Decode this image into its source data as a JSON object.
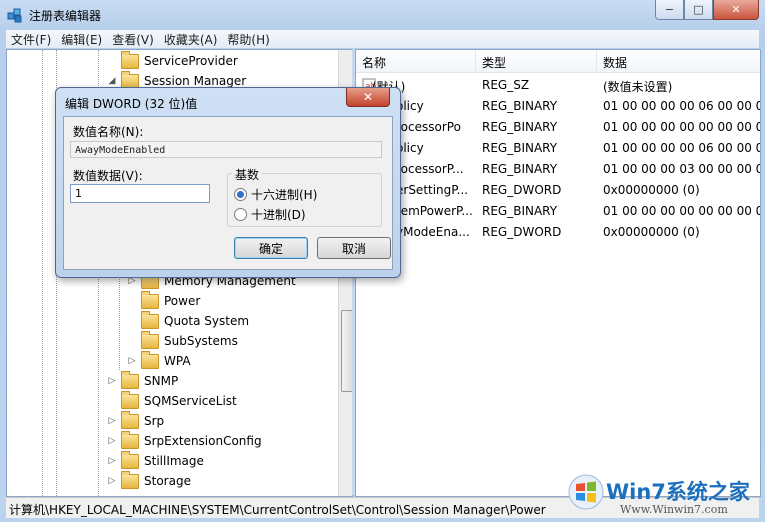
{
  "window": {
    "title": "注册表编辑器",
    "controls": {
      "minimize": "−",
      "maximize": "□",
      "close": "✕"
    }
  },
  "menu": [
    "文件(F)",
    "编辑(E)",
    "查看(V)",
    "收藏夹(A)",
    "帮助(H)"
  ],
  "tree": {
    "items": [
      {
        "label": "ServiceProvider",
        "expander": ""
      },
      {
        "label": "Session Manager",
        "expander": "◢"
      },
      {
        "label": "Memory Management",
        "expander": "▷"
      },
      {
        "label": "Power",
        "expander": ""
      },
      {
        "label": "Quota System",
        "expander": ""
      },
      {
        "label": "SubSystems",
        "expander": ""
      },
      {
        "label": "WPA",
        "expander": "▷"
      },
      {
        "label": "SNMP",
        "expander": "▷"
      },
      {
        "label": "SQMServiceList",
        "expander": ""
      },
      {
        "label": "Srp",
        "expander": "▷"
      },
      {
        "label": "SrpExtensionConfig",
        "expander": "▷"
      },
      {
        "label": "StillImage",
        "expander": "▷"
      },
      {
        "label": "Storage",
        "expander": "▷"
      }
    ]
  },
  "list": {
    "headers": {
      "name": "名称",
      "type": "类型",
      "data": "数据"
    },
    "rows": [
      {
        "name": "(默认)",
        "type": "REG_SZ",
        "data": "(数值未设置)"
      },
      {
        "name": "olicy",
        "type": "REG_BINARY",
        "data": "01 00 00 00 00 06 00 00 00 03"
      },
      {
        "name": "rocessorPo",
        "type": "REG_BINARY",
        "data": "01 00 00 00 00 00 00 00 00 00"
      },
      {
        "name": "olicy",
        "type": "REG_BINARY",
        "data": "01 00 00 00 00 06 00 00 00 03"
      },
      {
        "name": "rocessorP...",
        "type": "REG_BINARY",
        "data": "01 00 00 00 03 00 00 00 00 00"
      },
      {
        "name": "erSettingP...",
        "type": "REG_DWORD",
        "data": "0x00000000 (0)"
      },
      {
        "name": "temPowerP...",
        "type": "REG_BINARY",
        "data": "01 00 00 00 00 00 00 00 00 00"
      },
      {
        "name": "yModeEna...",
        "type": "REG_DWORD",
        "data": "0x00000000 (0)"
      }
    ]
  },
  "status": {
    "path": "计算机\\HKEY_LOCAL_MACHINE\\SYSTEM\\CurrentControlSet\\Control\\Session Manager\\Power"
  },
  "watermark": {
    "brand": "Win7系统之家",
    "url": "Www.Winwin7.com"
  },
  "dialog": {
    "title": "编辑 DWORD (32 位)值",
    "close": "✕",
    "name_label": "数值名称(N):",
    "name_value": "AwayModeEnabled",
    "data_label": "数值数据(V):",
    "data_value": "1",
    "base_label": "基数",
    "radio_hex": "十六进制(H)",
    "radio_dec": "十进制(D)",
    "selected_base": "hex",
    "ok": "确定",
    "cancel": "取消"
  }
}
